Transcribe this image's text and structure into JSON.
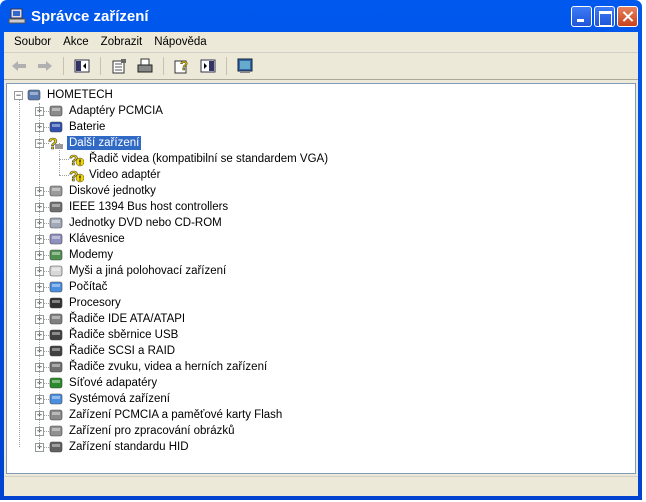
{
  "window": {
    "title": "Správce zařízení"
  },
  "menu": [
    "Soubor",
    "Akce",
    "Zobrazit",
    "Nápověda"
  ],
  "toolbar": [
    "back-icon",
    "forward-icon",
    "console-tree-icon",
    "properties-icon",
    "print-icon",
    "help-icon",
    "show-hide-icon",
    "scan-hardware-icon"
  ],
  "tree": {
    "root": "HOMETECH",
    "items": [
      {
        "label": "Adaptéry PCMCIA",
        "icon": "pcmcia-icon",
        "color": "#8a8a8a"
      },
      {
        "label": "Baterie",
        "icon": "battery-icon",
        "color": "#3050b0"
      },
      {
        "label": "Další zařízení",
        "icon": "unknown-device-icon",
        "color": "#f0d000",
        "expanded": true,
        "children": [
          "Řadič videa (kompatibilní se standardem VGA)",
          "Video adaptér"
        ]
      },
      {
        "label": "Diskové jednotky",
        "icon": "disk-icon",
        "color": "#9a9a9a"
      },
      {
        "label": "IEEE 1394 Bus host controllers",
        "icon": "ieee1394-icon",
        "color": "#707070"
      },
      {
        "label": "Jednotky DVD nebo CD-ROM",
        "icon": "cdrom-icon",
        "color": "#a0a8b8"
      },
      {
        "label": "Klávesnice",
        "icon": "keyboard-icon",
        "color": "#9090c0"
      },
      {
        "label": "Modemy",
        "icon": "modem-icon",
        "color": "#509050"
      },
      {
        "label": "Myši a jiná polohovací zařízení",
        "icon": "mouse-icon",
        "color": "#d8d8d8"
      },
      {
        "label": "Počítač",
        "icon": "computer-icon",
        "color": "#4a8ee0"
      },
      {
        "label": "Procesory",
        "icon": "processor-icon",
        "color": "#303030"
      },
      {
        "label": "Řadiče IDE ATA/ATAPI",
        "icon": "ide-icon",
        "color": "#808080"
      },
      {
        "label": "Řadiče sběrnice USB",
        "icon": "usb-icon",
        "color": "#404040"
      },
      {
        "label": "Řadiče SCSI a RAID",
        "icon": "scsi-icon",
        "color": "#404040"
      },
      {
        "label": "Řadiče zvuku, videa a herních zařízení",
        "icon": "sound-icon",
        "color": "#707070"
      },
      {
        "label": "Síťové adapatéry",
        "icon": "network-icon",
        "color": "#2a8a2a"
      },
      {
        "label": "Systémová zařízení",
        "icon": "system-icon",
        "color": "#4a8ee0"
      },
      {
        "label": "Zařízení PCMCIA a paměťové karty Flash",
        "icon": "flash-card-icon",
        "color": "#8a8a8a"
      },
      {
        "label": "Zařízení pro zpracování obrázků",
        "icon": "imaging-icon",
        "color": "#909090"
      },
      {
        "label": "Zařízení standardu HID",
        "icon": "hid-icon",
        "color": "#606060"
      }
    ]
  }
}
